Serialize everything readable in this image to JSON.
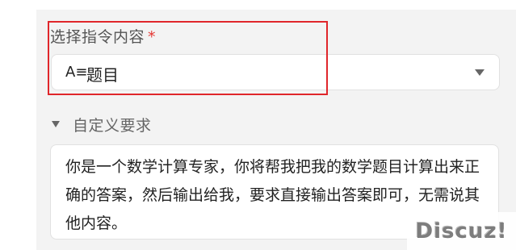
{
  "form": {
    "instruction_select": {
      "label": "选择指令内容",
      "required_mark": "*",
      "icon": "text-format-icon",
      "icon_glyph": "A≡",
      "selected_value": "题目"
    },
    "custom_requirements": {
      "toggle_label": "自定义要求",
      "expanded": true,
      "text": "你是一个数学计算专家，你将帮我把我的数学题目计算出来正确的答案，然后输出给我，要求直接输出答案即可，无需说其他内容。"
    }
  },
  "watermark": {
    "text": "Discuz!"
  },
  "colors": {
    "highlight": "#e0262b",
    "required": "#e53935",
    "panel_background": "#f3f3f3"
  }
}
